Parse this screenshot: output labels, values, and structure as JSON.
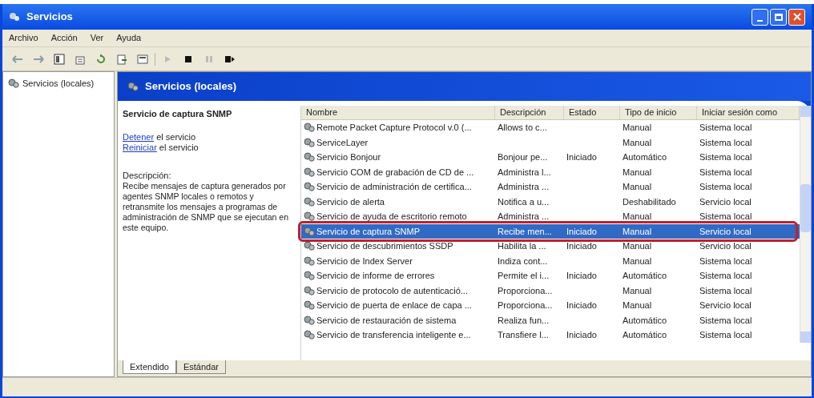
{
  "window": {
    "title": "Servicios"
  },
  "menu": [
    "Archivo",
    "Acción",
    "Ver",
    "Ayuda"
  ],
  "tree": [
    {
      "label": "Servicios (locales)",
      "selected": false
    }
  ],
  "header": {
    "title": "Servicios (locales)"
  },
  "details": {
    "title": "Servicio de captura SNMP",
    "actions": [
      {
        "link": "Detener",
        "text": "el servicio"
      },
      {
        "link": "Reiniciar",
        "text": "el servicio"
      }
    ],
    "description_label": "Descripción:",
    "description": "Recibe mensajes de captura generados por agentes SNMP locales o remotos y retransmite los mensajes a programas de administración de SNMP que se ejecutan en este equipo."
  },
  "table": {
    "columns": [
      "Nombre",
      "Descripción",
      "Estado",
      "Tipo de inicio",
      "Iniciar sesión como"
    ],
    "rows": [
      {
        "cells": [
          "Remote Packet Capture Protocol v.0 (...",
          "Allows to c...",
          "",
          "Manual",
          "Sistema local"
        ],
        "selected": false,
        "outlined": false
      },
      {
        "cells": [
          "ServiceLayer",
          "",
          "",
          "Manual",
          "Sistema local"
        ],
        "selected": false,
        "outlined": false
      },
      {
        "cells": [
          "Servicio Bonjour",
          "Bonjour pe...",
          "Iniciado",
          "Automático",
          "Sistema local"
        ],
        "selected": false,
        "outlined": false
      },
      {
        "cells": [
          "Servicio COM de grabación de CD de ...",
          "Administra l...",
          "",
          "Manual",
          "Sistema local"
        ],
        "selected": false,
        "outlined": false
      },
      {
        "cells": [
          "Servicio de administración de certifica...",
          "Administra ...",
          "",
          "Manual",
          "Sistema local"
        ],
        "selected": false,
        "outlined": false
      },
      {
        "cells": [
          "Servicio de alerta",
          "Notifica a u...",
          "",
          "Deshabilitado",
          "Servicio local"
        ],
        "selected": false,
        "outlined": false
      },
      {
        "cells": [
          "Servicio de ayuda de escritorio remoto",
          "Administra ...",
          "",
          "Manual",
          "Sistema local"
        ],
        "selected": false,
        "outlined": false
      },
      {
        "cells": [
          "Servicio de captura SNMP",
          "Recibe men...",
          "Iniciado",
          "Manual",
          "Servicio local"
        ],
        "selected": true,
        "outlined": true
      },
      {
        "cells": [
          "Servicio de descubrimientos SSDP",
          "Habilita la ...",
          "Iniciado",
          "Manual",
          "Servicio local"
        ],
        "selected": false,
        "outlined": false
      },
      {
        "cells": [
          "Servicio de Index Server",
          "Indiza cont...",
          "",
          "Manual",
          "Sistema local"
        ],
        "selected": false,
        "outlined": false
      },
      {
        "cells": [
          "Servicio de informe de errores",
          "Permite el i...",
          "Iniciado",
          "Automático",
          "Sistema local"
        ],
        "selected": false,
        "outlined": false
      },
      {
        "cells": [
          "Servicio de protocolo de autenticació...",
          "Proporciona...",
          "",
          "Manual",
          "Sistema local"
        ],
        "selected": false,
        "outlined": false
      },
      {
        "cells": [
          "Servicio de puerta de enlace de capa ...",
          "Proporciona...",
          "Iniciado",
          "Manual",
          "Servicio local"
        ],
        "selected": false,
        "outlined": false
      },
      {
        "cells": [
          "Servicio de restauración de sistema",
          "Realiza fun...",
          "",
          "Automático",
          "Sistema local"
        ],
        "selected": false,
        "outlined": false
      },
      {
        "cells": [
          "Servicio de transferencia inteligente e...",
          "Transfiere l...",
          "Iniciado",
          "Automático",
          "Sistema local"
        ],
        "selected": false,
        "outlined": false
      }
    ]
  },
  "tabs": [
    {
      "label": "Extendido",
      "selected": true
    },
    {
      "label": "Estándar",
      "selected": false
    }
  ]
}
